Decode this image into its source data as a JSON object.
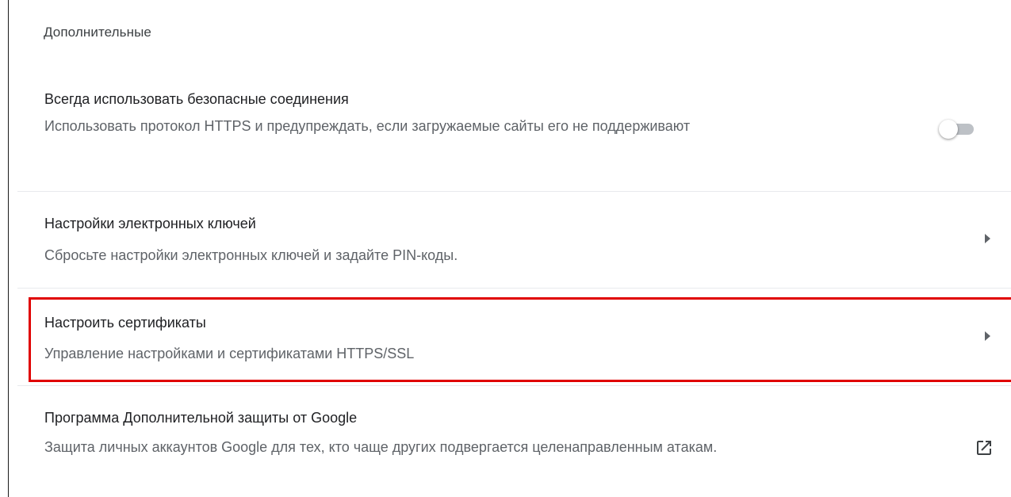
{
  "section": {
    "heading": "Дополнительные"
  },
  "rows": [
    {
      "title": "Всегда использовать безопасные соединения",
      "description": "Использовать протокол HTTPS и предупреждать, если загружаемые сайты его не поддерживают",
      "control": "toggle",
      "toggle_on": false
    },
    {
      "title": "Настройки электронных ключей",
      "description": "Сбросьте настройки электронных ключей и задайте PIN-коды.",
      "control": "chevron-right-icon"
    },
    {
      "title": "Настроить сертификаты",
      "description": "Управление настройками и сертификатами HTTPS/SSL",
      "control": "chevron-right-icon",
      "highlighted": true
    },
    {
      "title": "Программа Дополнительной защиты от Google",
      "description": "Защита личных аккаунтов Google для тех, кто чаще других подвергается целенаправленным атакам.",
      "control": "open-in-new-icon"
    }
  ],
  "colors": {
    "highlight_border": "#e00000",
    "toggle_track_off": "#bdc1c6",
    "primary_text": "#202124",
    "secondary_text": "#5f6368"
  }
}
